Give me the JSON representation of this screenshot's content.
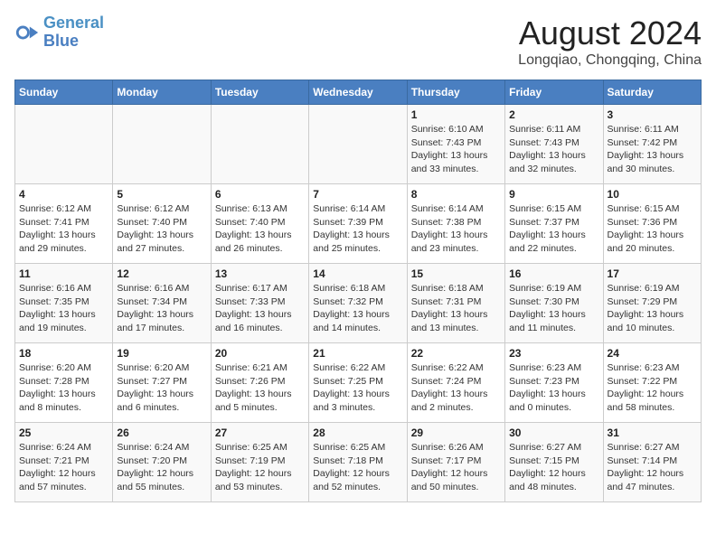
{
  "logo": {
    "line1": "General",
    "line2": "Blue"
  },
  "title": "August 2024",
  "subtitle": "Longqiao, Chongqing, China",
  "days_of_week": [
    "Sunday",
    "Monday",
    "Tuesday",
    "Wednesday",
    "Thursday",
    "Friday",
    "Saturday"
  ],
  "weeks": [
    [
      {
        "day": "",
        "info": ""
      },
      {
        "day": "",
        "info": ""
      },
      {
        "day": "",
        "info": ""
      },
      {
        "day": "",
        "info": ""
      },
      {
        "day": "1",
        "info": "Sunrise: 6:10 AM\nSunset: 7:43 PM\nDaylight: 13 hours\nand 33 minutes."
      },
      {
        "day": "2",
        "info": "Sunrise: 6:11 AM\nSunset: 7:43 PM\nDaylight: 13 hours\nand 32 minutes."
      },
      {
        "day": "3",
        "info": "Sunrise: 6:11 AM\nSunset: 7:42 PM\nDaylight: 13 hours\nand 30 minutes."
      }
    ],
    [
      {
        "day": "4",
        "info": "Sunrise: 6:12 AM\nSunset: 7:41 PM\nDaylight: 13 hours\nand 29 minutes."
      },
      {
        "day": "5",
        "info": "Sunrise: 6:12 AM\nSunset: 7:40 PM\nDaylight: 13 hours\nand 27 minutes."
      },
      {
        "day": "6",
        "info": "Sunrise: 6:13 AM\nSunset: 7:40 PM\nDaylight: 13 hours\nand 26 minutes."
      },
      {
        "day": "7",
        "info": "Sunrise: 6:14 AM\nSunset: 7:39 PM\nDaylight: 13 hours\nand 25 minutes."
      },
      {
        "day": "8",
        "info": "Sunrise: 6:14 AM\nSunset: 7:38 PM\nDaylight: 13 hours\nand 23 minutes."
      },
      {
        "day": "9",
        "info": "Sunrise: 6:15 AM\nSunset: 7:37 PM\nDaylight: 13 hours\nand 22 minutes."
      },
      {
        "day": "10",
        "info": "Sunrise: 6:15 AM\nSunset: 7:36 PM\nDaylight: 13 hours\nand 20 minutes."
      }
    ],
    [
      {
        "day": "11",
        "info": "Sunrise: 6:16 AM\nSunset: 7:35 PM\nDaylight: 13 hours\nand 19 minutes."
      },
      {
        "day": "12",
        "info": "Sunrise: 6:16 AM\nSunset: 7:34 PM\nDaylight: 13 hours\nand 17 minutes."
      },
      {
        "day": "13",
        "info": "Sunrise: 6:17 AM\nSunset: 7:33 PM\nDaylight: 13 hours\nand 16 minutes."
      },
      {
        "day": "14",
        "info": "Sunrise: 6:18 AM\nSunset: 7:32 PM\nDaylight: 13 hours\nand 14 minutes."
      },
      {
        "day": "15",
        "info": "Sunrise: 6:18 AM\nSunset: 7:31 PM\nDaylight: 13 hours\nand 13 minutes."
      },
      {
        "day": "16",
        "info": "Sunrise: 6:19 AM\nSunset: 7:30 PM\nDaylight: 13 hours\nand 11 minutes."
      },
      {
        "day": "17",
        "info": "Sunrise: 6:19 AM\nSunset: 7:29 PM\nDaylight: 13 hours\nand 10 minutes."
      }
    ],
    [
      {
        "day": "18",
        "info": "Sunrise: 6:20 AM\nSunset: 7:28 PM\nDaylight: 13 hours\nand 8 minutes."
      },
      {
        "day": "19",
        "info": "Sunrise: 6:20 AM\nSunset: 7:27 PM\nDaylight: 13 hours\nand 6 minutes."
      },
      {
        "day": "20",
        "info": "Sunrise: 6:21 AM\nSunset: 7:26 PM\nDaylight: 13 hours\nand 5 minutes."
      },
      {
        "day": "21",
        "info": "Sunrise: 6:22 AM\nSunset: 7:25 PM\nDaylight: 13 hours\nand 3 minutes."
      },
      {
        "day": "22",
        "info": "Sunrise: 6:22 AM\nSunset: 7:24 PM\nDaylight: 13 hours\nand 2 minutes."
      },
      {
        "day": "23",
        "info": "Sunrise: 6:23 AM\nSunset: 7:23 PM\nDaylight: 13 hours\nand 0 minutes."
      },
      {
        "day": "24",
        "info": "Sunrise: 6:23 AM\nSunset: 7:22 PM\nDaylight: 12 hours\nand 58 minutes."
      }
    ],
    [
      {
        "day": "25",
        "info": "Sunrise: 6:24 AM\nSunset: 7:21 PM\nDaylight: 12 hours\nand 57 minutes."
      },
      {
        "day": "26",
        "info": "Sunrise: 6:24 AM\nSunset: 7:20 PM\nDaylight: 12 hours\nand 55 minutes."
      },
      {
        "day": "27",
        "info": "Sunrise: 6:25 AM\nSunset: 7:19 PM\nDaylight: 12 hours\nand 53 minutes."
      },
      {
        "day": "28",
        "info": "Sunrise: 6:25 AM\nSunset: 7:18 PM\nDaylight: 12 hours\nand 52 minutes."
      },
      {
        "day": "29",
        "info": "Sunrise: 6:26 AM\nSunset: 7:17 PM\nDaylight: 12 hours\nand 50 minutes."
      },
      {
        "day": "30",
        "info": "Sunrise: 6:27 AM\nSunset: 7:15 PM\nDaylight: 12 hours\nand 48 minutes."
      },
      {
        "day": "31",
        "info": "Sunrise: 6:27 AM\nSunset: 7:14 PM\nDaylight: 12 hours\nand 47 minutes."
      }
    ]
  ]
}
